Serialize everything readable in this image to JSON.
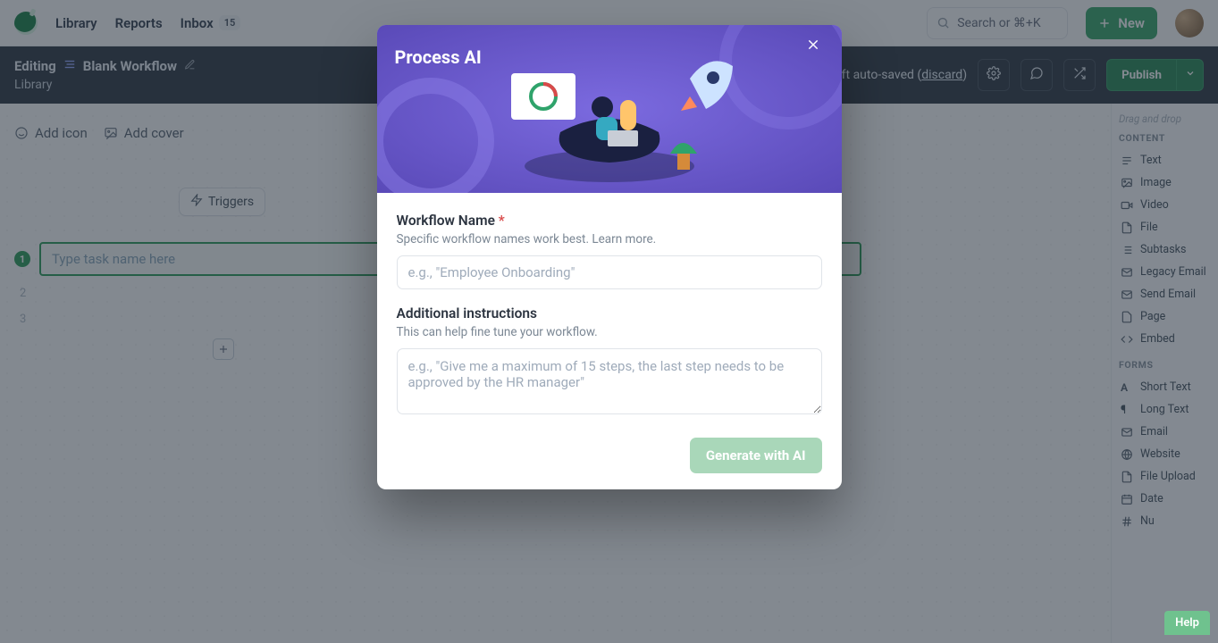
{
  "topnav": {
    "library": "Library",
    "reports": "Reports",
    "inbox": "Inbox",
    "inbox_count": "15",
    "search_placeholder": "Search or ⌘+K",
    "new_label": "New"
  },
  "subbar": {
    "editing": "Editing",
    "workflow_name": "Blank Workflow",
    "breadcrumb": "Library",
    "autosave": "Draft auto-saved (",
    "discard": "discard",
    "autosave_close": ")",
    "publish": "Publish"
  },
  "canvas": {
    "add_icon": "Add icon",
    "add_cover": "Add cover",
    "triggers": "Triggers",
    "task_placeholder": "Type task name here",
    "row1": "1",
    "row2": "2",
    "row3": "3"
  },
  "panel": {
    "hint": "Drag and drop",
    "content_heading": "CONTENT",
    "forms_heading": "FORMS",
    "content": {
      "text": "Text",
      "image": "Image",
      "video": "Video",
      "file": "File",
      "subtasks": "Subtasks",
      "legacy_email": "Legacy Email",
      "send_email": "Send Email",
      "page": "Page",
      "embed": "Embed"
    },
    "forms": {
      "short_text": "Short Text",
      "long_text": "Long Text",
      "email": "Email",
      "website": "Website",
      "file_upload": "File Upload",
      "date": "Date",
      "number": "Nu"
    }
  },
  "modal": {
    "title": "Process AI",
    "name_label": "Workflow Name",
    "name_hint": "Specific workflow names work best. Learn more.",
    "name_placeholder": "e.g., \"Employee Onboarding\"",
    "addl_label": "Additional instructions",
    "addl_hint": "This can help fine tune your workflow.",
    "addl_placeholder": "e.g., \"Give me a maximum of 15 steps, the last step needs to be approved by the HR manager\"",
    "generate": "Generate with AI"
  },
  "help": "Help"
}
